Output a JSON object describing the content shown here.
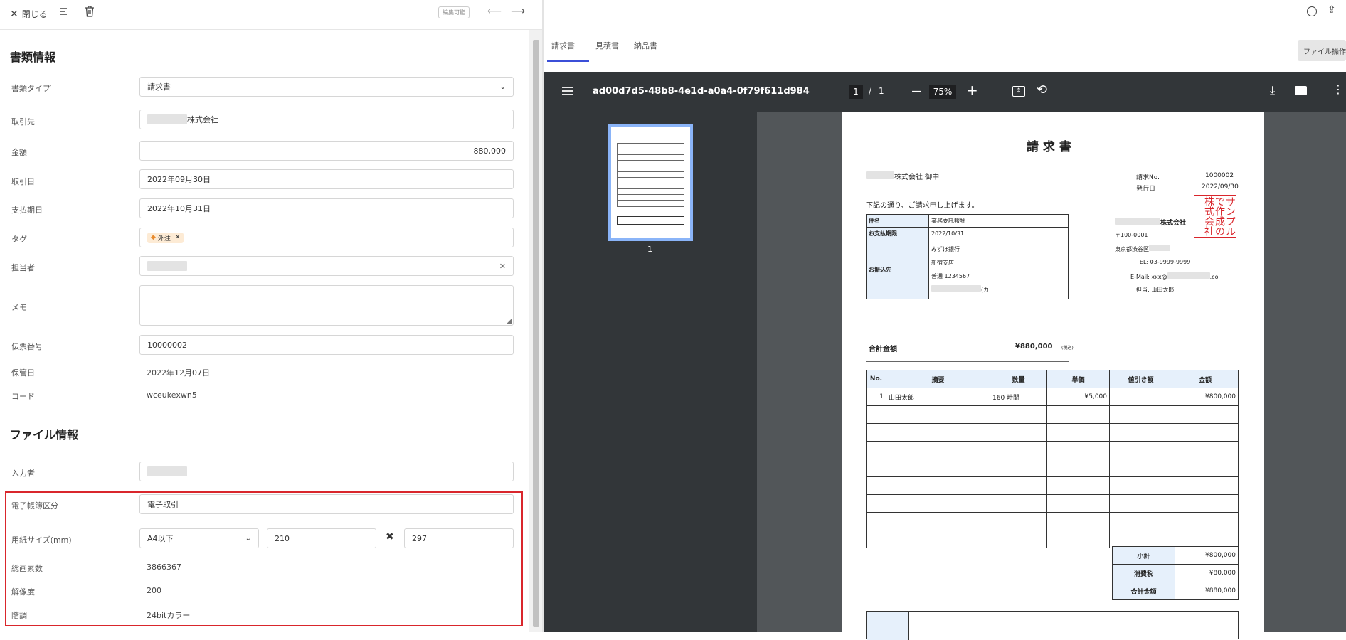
{
  "toolbar": {
    "close": "閉じる",
    "badge": "編集可能"
  },
  "doc_info": {
    "title": "書類情報",
    "type_label": "書類タイプ",
    "type_value": "請求書",
    "partner_label": "取引先",
    "partner_value": "株式会社",
    "amount_label": "金額",
    "amount_value": "880,000",
    "date_label": "取引日",
    "date_value": "2022年09月30日",
    "due_label": "支払期日",
    "due_value": "2022年10月31日",
    "tag_label": "タグ",
    "tag_value": "外注",
    "person_label": "担当者",
    "memo_label": "メモ",
    "slip_label": "伝票番号",
    "slip_value": "10000002",
    "kept_label": "保管日",
    "kept_value": "2022年12月07日",
    "code_label": "コード",
    "code_value": "wceukexwn5"
  },
  "file_info": {
    "title": "ファイル情報",
    "entered_label": "入力者",
    "ledger_label": "電子帳簿区分",
    "ledger_value": "電子取引",
    "paper_label": "用紙サイズ(mm)",
    "paper_value": "A4以下",
    "width": "210",
    "height": "297",
    "pixels_label": "総画素数",
    "pixels_value": "3866367",
    "res_label": "解像度",
    "res_value": "200",
    "tone_label": "階調",
    "tone_value": "24bitカラー"
  },
  "right": {
    "tabs": [
      "請求書",
      "見積書",
      "納品書"
    ],
    "file_op": "ファイル操作",
    "pdf_name": "ad00d7d5-48b8-4e1d-a0a4-0f79f611d984",
    "page_current": "1",
    "page_sep": "/",
    "page_total": "1",
    "zoom": "75%",
    "thumb_no": "1"
  },
  "invoice": {
    "title": "請 求 書",
    "to": "株式会社 御中",
    "no_label": "請求No.",
    "no": "1000002",
    "issue_label": "発行日",
    "issue": "2022/09/30",
    "lead": "下記の通り、ご請求申し上げます。",
    "stamp": "サンプルで作成の株式会社",
    "subject_label": "件名",
    "subject": "業務委託報酬",
    "pay_due_label": "お支払期限",
    "pay_due": "2022/10/31",
    "bank_label": "お振込先",
    "bank": "みずほ銀行",
    "branch": "新宿支店",
    "account": "普通 1234567",
    "holder": "(カ",
    "issuer": "株式会社",
    "zip": "〒100-0001",
    "addr": "東京都渋谷区",
    "tel": "TEL: 03-9999-9999",
    "email": "E-Mail: xxx@",
    "email_tail": ".co",
    "rep": "担当: 山田太郎",
    "total_label": "合計金額",
    "total": "¥880,000",
    "tax_note": "(税込)",
    "cols": [
      "No.",
      "摘要",
      "数量",
      "単価",
      "値引き額",
      "金額"
    ],
    "row1": [
      "1",
      "山田太郎",
      "160 時間",
      "¥5,000",
      "",
      "¥800,000"
    ],
    "sub_label": "小計",
    "sub": "¥800,000",
    "tax_label": "消費税",
    "tax": "¥80,000",
    "grand_label": "合計金額",
    "grand": "¥880,000"
  }
}
